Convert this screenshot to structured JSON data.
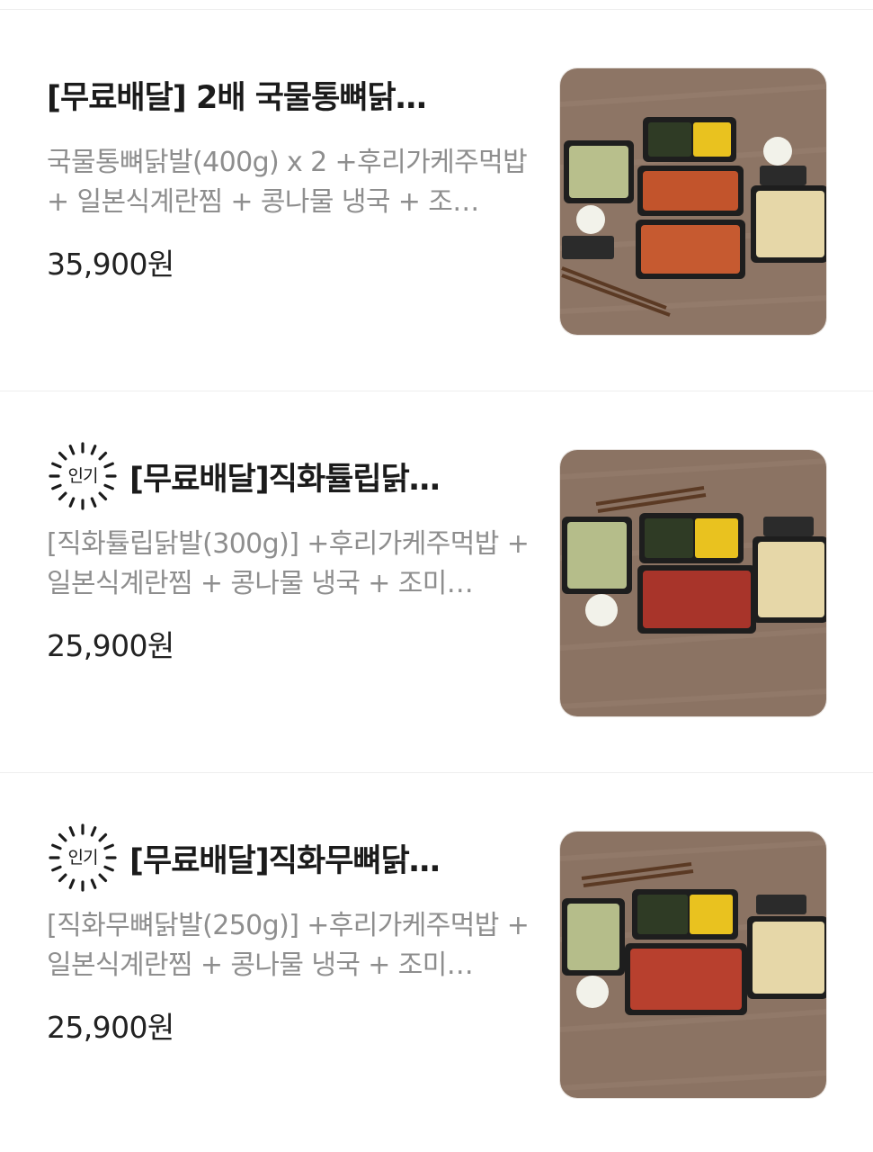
{
  "items": [
    {
      "badge": "",
      "title": "[무료배달] 2배 국물통뼈닭…",
      "description": "국물통뼈닭발(400g) x 2 +후리가케주먹밥 + 일본식계란찜 + 콩나물 냉국 + 조…",
      "price": "35,900원",
      "image_icon": "food-photo"
    },
    {
      "badge": "인기",
      "title": "[무료배달]직화튤립닭…",
      "description": "[직화튤립닭발(300g)] +후리가케주먹밥 + 일본식계란찜 + 콩나물 냉국 + 조미…",
      "price": "25,900원",
      "image_icon": "food-photo"
    },
    {
      "badge": "인기",
      "title": "[무료배달]직화무뼈닭…",
      "description": "[직화무뼈닭발(250g)] +후리가케주먹밥 + 일본식계란찜 + 콩나물 냉국 + 조미…",
      "price": "25,900원",
      "image_icon": "food-photo"
    }
  ],
  "colors": {
    "title": "#1b1b1b",
    "description": "#8e8e8e",
    "price": "#222222",
    "divider": "#eeeeee",
    "table": "#8a7261"
  }
}
